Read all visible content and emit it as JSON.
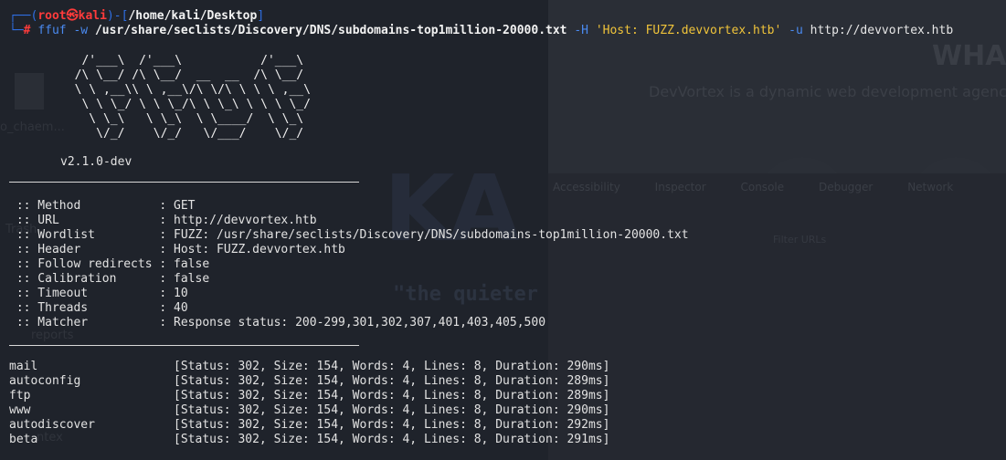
{
  "background": {
    "page_heading": "WHA",
    "tagline": "DevVortex is a dynamic web development agenc",
    "devtools_tabs": [
      "Accessibility",
      "Inspector",
      "Console",
      "Debugger",
      "Network"
    ],
    "devtools_filter": "Filter URLs",
    "desktop_brand": "KA",
    "desktop_quote": "\"the quieter",
    "desktop_labels": [
      "o_chaem...",
      "reports",
      "Trash",
      "ntex"
    ]
  },
  "prompt": {
    "user": "root",
    "at_symbol": "㉿",
    "host": "kali",
    "path": "/home/kali/Desktop",
    "hash": "#",
    "command": "ffuf",
    "flag_w": "-w",
    "wordlist_path": "/usr/share/seclists/Discovery/DNS/subdomains-top1million-20000.txt",
    "flag_H": "-H",
    "header_arg": "'Host: FUZZ.devvortex.htb'",
    "flag_u": "-u",
    "url": "http://devvortex.htb"
  },
  "banner": {
    "ascii": "   /'___\\  /'___\\           /'___\\       \n  /\\ \\__/ /\\ \\__/  __  __  /\\ \\__/       \n  \\ \\ ,__\\\\ \\ ,__\\/\\ \\/\\ \\ \\ \\ ,__\\      \n   \\ \\ \\_/ \\ \\ \\_/\\ \\ \\_\\ \\ \\ \\ \\_/      \n    \\ \\_\\   \\ \\_\\  \\ \\____/  \\ \\_\\       \n     \\/_/    \\/_/   \\/___/    \\/_/       ",
    "version": "v2.1.0-dev"
  },
  "config": [
    {
      "key": " :: Method           ",
      "value": "GET"
    },
    {
      "key": " :: URL              ",
      "value": "http://devvortex.htb"
    },
    {
      "key": " :: Wordlist         ",
      "value": "FUZZ: /usr/share/seclists/Discovery/DNS/subdomains-top1million-20000.txt"
    },
    {
      "key": " :: Header           ",
      "value": "Host: FUZZ.devvortex.htb"
    },
    {
      "key": " :: Follow redirects ",
      "value": "false"
    },
    {
      "key": " :: Calibration      ",
      "value": "false"
    },
    {
      "key": " :: Timeout          ",
      "value": "10"
    },
    {
      "key": " :: Threads          ",
      "value": "40"
    },
    {
      "key": " :: Matcher          ",
      "value": "Response status: 200-299,301,302,307,401,403,405,500"
    }
  ],
  "results": [
    {
      "name": "mail                   ",
      "info": "[Status: 302, Size: 154, Words: 4, Lines: 8, Duration: 290ms]"
    },
    {
      "name": "autoconfig             ",
      "info": "[Status: 302, Size: 154, Words: 4, Lines: 8, Duration: 289ms]"
    },
    {
      "name": "ftp                    ",
      "info": "[Status: 302, Size: 154, Words: 4, Lines: 8, Duration: 289ms]"
    },
    {
      "name": "www                    ",
      "info": "[Status: 302, Size: 154, Words: 4, Lines: 8, Duration: 290ms]"
    },
    {
      "name": "autodiscover           ",
      "info": "[Status: 302, Size: 154, Words: 4, Lines: 8, Duration: 292ms]"
    },
    {
      "name": "beta                   ",
      "info": "[Status: 302, Size: 154, Words: 4, Lines: 8, Duration: 291ms]"
    }
  ],
  "colors": {
    "terminal_bg": "#1f232b",
    "prompt_blue": "#2f6fe4",
    "prompt_red": "#ff3b3b",
    "string_yellow": "#f0c43a"
  }
}
